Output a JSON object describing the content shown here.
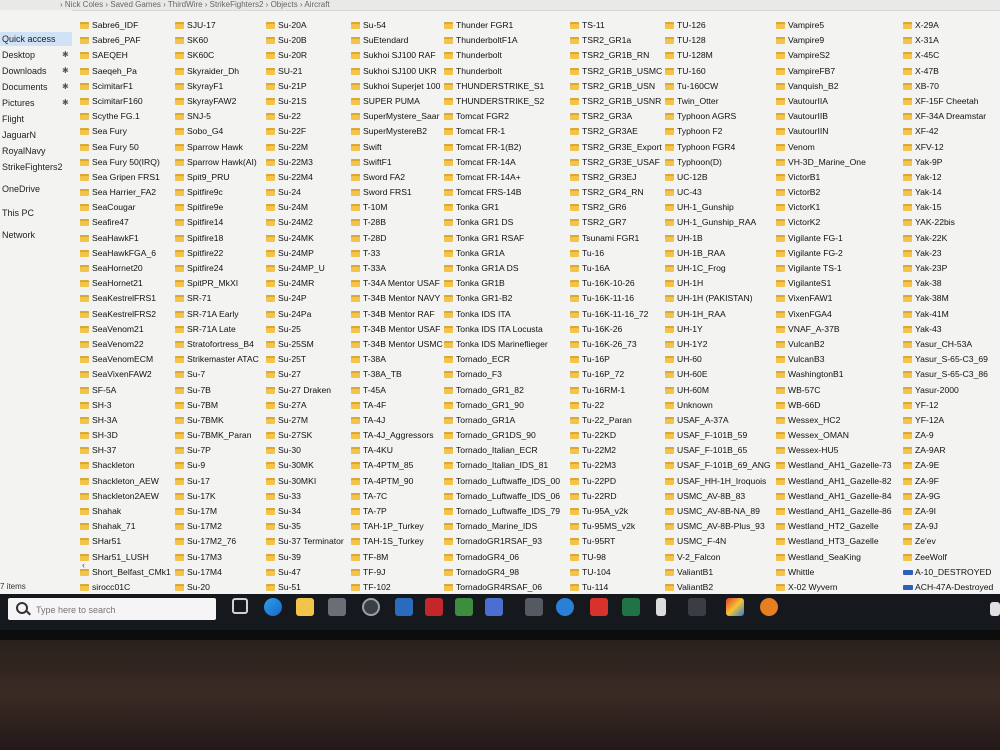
{
  "window": {
    "path": "› Nick Coles › Saved Games › ThirdWire › StrikeFighters2 › Objects › Aircraft"
  },
  "nav": [
    {
      "label": "Quick access",
      "selected": true,
      "pinned": false
    },
    {
      "label": "Desktop",
      "pinned": true
    },
    {
      "label": "Downloads",
      "pinned": true
    },
    {
      "label": "Documents",
      "pinned": true
    },
    {
      "label": "Pictures",
      "pinned": true
    },
    {
      "label": "Flight",
      "pinned": false
    },
    {
      "label": "JaguarN",
      "pinned": false
    },
    {
      "label": "RoyalNavy",
      "pinned": false
    },
    {
      "label": "StrikeFighters2",
      "pinned": false
    },
    {
      "label": "OneDrive",
      "pinned": false
    },
    {
      "label": "This PC",
      "pinned": false
    },
    {
      "label": "Network",
      "pinned": false
    }
  ],
  "status": {
    "items": "7 items"
  },
  "columns": [
    [
      "Sabre6_IDF",
      "Sabre6_PAF",
      "SAEQEH",
      "Saeqeh_Pa",
      "ScimitarF1",
      "ScimitarF160",
      "Scythe FG.1",
      "Sea Fury",
      "Sea Fury 50",
      "Sea Fury 50(IRQ)",
      "Sea Gripen FRS1",
      "Sea Harrier_FA2",
      "SeaCougar",
      "Seafire47",
      "SeaHawkF1",
      "SeaHawkFGA_6",
      "SeaHornet20",
      "SeaHornet21",
      "SeaKestrelFRS1",
      "SeaKestrelFRS2",
      "SeaVenom21",
      "SeaVenom22",
      "SeaVenomECM",
      "SeaVixenFAW2",
      "SF-5A",
      "SH-3",
      "SH-3A",
      "SH-3D",
      "SH-37",
      "Shackleton",
      "Shackleton_AEW",
      "Shackleton2AEW",
      "Shahak",
      "Shahak_71",
      "SHar51",
      "SHar51_LUSH",
      "Short_Belfast_CMk1",
      "sirocc01C"
    ],
    [
      "SJU-17",
      "SK60",
      "SK60C",
      "Skyraider_Dh",
      "SkyrayF1",
      "SkyrayFAW2",
      "SNJ-5",
      "Sobo_G4",
      "Sparrow Hawk",
      "Sparrow Hawk(AI)",
      "Spit9_PRU",
      "Spitfire9c",
      "Spitfire9e",
      "Spitfire14",
      "Spitfire18",
      "Spitfire22",
      "Spitfire24",
      "SpitPR_MkXI",
      "SR-71",
      "SR-71A Early",
      "SR-71A Late",
      "Stratofortress_B4",
      "Strikemaster ATAC",
      "Su-7",
      "Su-7B",
      "Su-7BM",
      "Su-7BMK",
      "Su-7BMK_Paran",
      "Su-7P",
      "Su-9",
      "Su-17",
      "Su-17K",
      "Su-17M",
      "Su-17M2",
      "Su-17M2_76",
      "Su-17M3",
      "Su-17M4",
      "Su-20"
    ],
    [
      "Su-20A",
      "Su-20B",
      "Su-20R",
      "SU-21",
      "Su-21P",
      "Su-21S",
      "Su-22",
      "Su-22F",
      "Su-22M",
      "Su-22M3",
      "Su-22M4",
      "Su-24",
      "Su-24M",
      "Su-24M2",
      "Su-24MK",
      "Su-24MP",
      "Su-24MP_U",
      "Su-24MR",
      "Su-24P",
      "Su-24Pa",
      "Su-25",
      "Su-25SM",
      "Su-25T",
      "Su-27",
      "Su-27 Draken",
      "Su-27A",
      "Su-27M",
      "Su-27SK",
      "Su-30",
      "Su-30MK",
      "Su-30MKI",
      "Su-33",
      "Su-34",
      "Su-35",
      "Su-37 Terminator",
      "Su-39",
      "Su-47",
      "Su-51"
    ],
    [
      "Su-54",
      "SuEtendard",
      "Sukhoi SJ100 RAF",
      "Sukhoi SJ100 UKR",
      "Sukhoi Superjet 100",
      "SUPER PUMA",
      "SuperMystere_Saar",
      "SuperMystereB2",
      "Swift",
      "SwiftF1",
      "Sword FA2",
      "Sword FRS1",
      "T-10M",
      "T-28B",
      "T-28D",
      "T-33",
      "T-33A",
      "T-34A Mentor USAF",
      "T-34B Mentor NAVY",
      "T-34B Mentor RAF",
      "T-34B Mentor USAF",
      "T-34B Mentor USMC",
      "T-38A",
      "T-38A_TB",
      "T-45A",
      "TA-4F",
      "TA-4J",
      "TA-4J_Aggressors",
      "TA-4KU",
      "TA-4PTM_85",
      "TA-4PTM_90",
      "TA-7C",
      "TA-7P",
      "TAH-1P_Turkey",
      "TAH-1S_Turkey",
      "TF-8M",
      "TF-9J",
      "TF-102"
    ],
    [
      "Thunder FGR1",
      "ThunderboltF1A",
      "Thunderbolt",
      "Thunderbolt",
      "THUNDERSTRIKE_S1",
      "THUNDERSTRIKE_S2",
      "Tomcat FGR2",
      "Tomcat FR-1",
      "Tomcat FR-1(B2)",
      "Tomcat FR-14A",
      "Tomcat FR-14A+",
      "Tomcat FRS-14B",
      "Tonka GR1",
      "Tonka GR1 DS",
      "Tonka GR1 RSAF",
      "Tonka GR1A",
      "Tonka GR1A DS",
      "Tonka GR1B",
      "Tonka GR1-B2",
      "Tonka IDS ITA",
      "Tonka IDS ITA Locusta",
      "Tonka IDS Marineflieger",
      "Tornado_ECR",
      "Tornado_F3",
      "Tornado_GR1_82",
      "Tornado_GR1_90",
      "Tornado_GR1A",
      "Tornado_GR1DS_90",
      "Tornado_Italian_ECR",
      "Tornado_Italian_IDS_81",
      "Tornado_Luftwaffe_IDS_00",
      "Tornado_Luftwaffe_IDS_06",
      "Tornado_Luftwaffe_IDS_79",
      "Tornado_Marine_IDS",
      "TornadoGR1RSAF_93",
      "TornadoGR4_06",
      "TornadoGR4_98",
      "TornadoGR4RSAF_06"
    ],
    [
      "TS-11",
      "TSR2_GR1a",
      "TSR2_GR1B_RN",
      "TSR2_GR1B_USMC",
      "TSR2_GR1B_USN",
      "TSR2_GR1B_USNR",
      "TSR2_GR3A",
      "TSR2_GR3AE",
      "TSR2_GR3E_Export",
      "TSR2_GR3E_USAF",
      "TSR2_GR3EJ",
      "TSR2_GR4_RN",
      "TSR2_GR6",
      "TSR2_GR7",
      "Tsunami FGR1",
      "Tu-16",
      "Tu-16A",
      "Tu-16K-10-26",
      "Tu-16K-11-16",
      "Tu-16K-11-16_72",
      "Tu-16K-26",
      "Tu-16K-26_73",
      "Tu-16P",
      "Tu-16P_72",
      "Tu-16RM-1",
      "Tu-22",
      "Tu-22_Paran",
      "Tu-22KD",
      "Tu-22M2",
      "Tu-22M3",
      "Tu-22PD",
      "Tu-22RD",
      "Tu-95A_v2k",
      "Tu-95MS_v2k",
      "Tu-95RT",
      "TU-98",
      "TU-104",
      "Tu-114"
    ],
    [
      "TU-126",
      "TU-128",
      "TU-128M",
      "TU-160",
      "Tu-160CW",
      "Twin_Otter",
      "Typhoon AGRS",
      "Typhoon F2",
      "Typhoon FGR4",
      "Typhoon(D)",
      "UC-12B",
      "UC-43",
      "UH-1_Gunship",
      "UH-1_Gunship_RAA",
      "UH-1B",
      "UH-1B_RAA",
      "UH-1C_Frog",
      "UH-1H",
      "UH-1H (PAKISTAN)",
      "UH-1H_RAA",
      "UH-1Y",
      "UH-1Y2",
      "UH-60",
      "UH-60E",
      "UH-60M",
      "Unknown",
      "USAF_A-37A",
      "USAF_F-101B_59",
      "USAF_F-101B_65",
      "USAF_F-101B_69_ANG",
      "USAF_HH-1H_Iroquois",
      "USMC_AV-8B_83",
      "USMC_AV-8B-NA_89",
      "USMC_AV-8B-Plus_93",
      "USMC_F-4N",
      "V-2_Falcon",
      "ValiantB1",
      "ValiantB2"
    ],
    [
      "Vampire5",
      "Vampire9",
      "VampireS2",
      "VampireFB7",
      "Vanquish_B2",
      "VautourIIA",
      "VautourIIB",
      "VautourIIN",
      "Venom",
      "VH-3D_Marine_One",
      "VictorB1",
      "VictorB2",
      "VictorK1",
      "VictorK2",
      "Vigilante FG-1",
      "Vigilante FG-2",
      "Vigilante TS-1",
      "VigilanteS1",
      "VixenFAW1",
      "VixenFGA4",
      "VNAF_A-37B",
      "VulcanB2",
      "VulcanB3",
      "WashingtonB1",
      "WB-57C",
      "WB-66D",
      "Wessex_HC2",
      "Wessex_OMAN",
      "Wessex-HU5",
      "Westland_AH1_Gazelle-73",
      "Westland_AH1_Gazelle-82",
      "Westland_AH1_Gazelle-84",
      "Westland_AH1_Gazelle-86",
      "Westland_HT2_Gazelle",
      "Westland_HT3_Gazelle",
      "Westland_SeaKing",
      "Whittle",
      "X-02 Wyvern"
    ],
    [
      "X-29A",
      "X-31A",
      "X-45C",
      "X-47B",
      "XB-70",
      "XF-15F Cheetah",
      "XF-34A Dreamstar",
      "XF-42",
      "XFV-12",
      "Yak-9P",
      "Yak-12",
      "Yak-14",
      "Yak-15",
      "YAK-22bis",
      "Yak-22K",
      "Yak-23",
      "Yak-23P",
      "Yak-38",
      "Yak-38M",
      "Yak-41M",
      "Yak-43",
      "Yasur_CH-53A",
      "Yasur_S-65-C3_69",
      "Yasur_S-65-C3_86",
      "Yasur-2000",
      "YF-12",
      "YF-12A",
      "ZA-9",
      "ZA-9AR",
      "ZA-9E",
      "ZA-9F",
      "ZA-9G",
      "ZA-9I",
      "ZA-9J",
      "Ze'ev",
      "ZeeWolf",
      "A-10_DESTROYED",
      "ACH-47A-Destroyed"
    ]
  ],
  "file_items": [
    "A-10_DESTROYED",
    "ACH-47A-Destroyed"
  ],
  "taskbar": {
    "search_placeholder": "Type here to search"
  }
}
